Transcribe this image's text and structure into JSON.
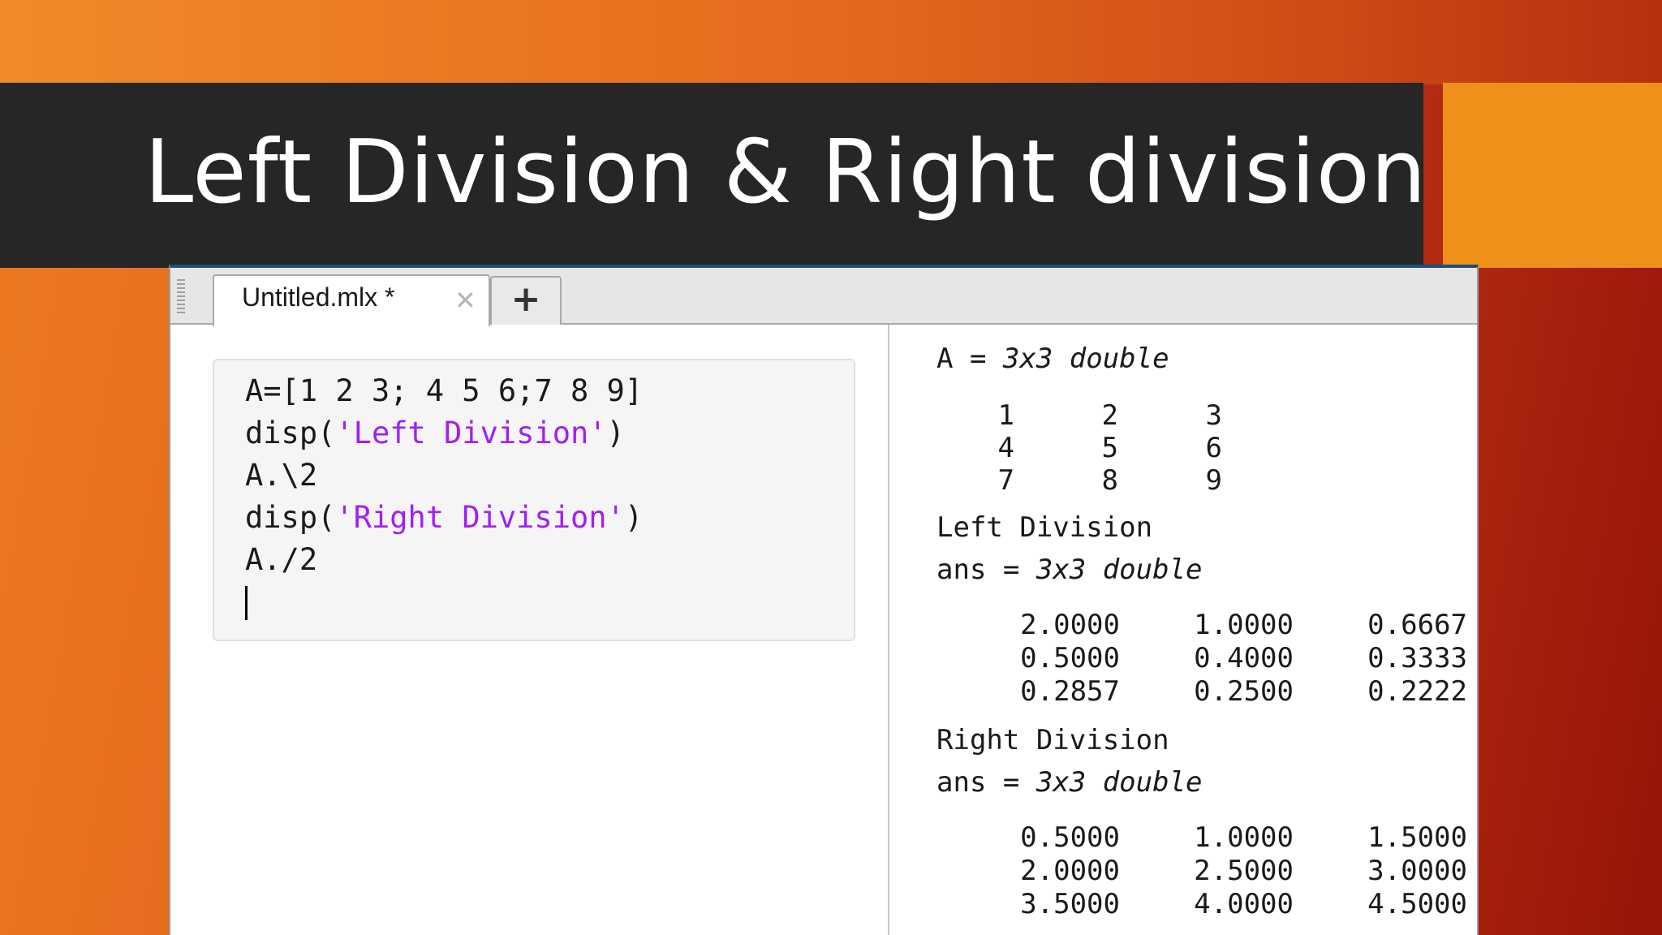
{
  "slide": {
    "title": "Left Division & Right division"
  },
  "editor": {
    "tab_label": "Untitled.mlx *",
    "tab_close_icon": "close-icon",
    "new_tab_label": "+",
    "code_lines": [
      {
        "plain": "A=[1 2 3; 4 5 6;7 8 9]",
        "pre": "",
        "str": "",
        "post": ""
      },
      {
        "plain": "",
        "pre": "disp(",
        "str": "'Left Division'",
        "post": ")"
      },
      {
        "plain": "A.\\2",
        "pre": "",
        "str": "",
        "post": ""
      },
      {
        "plain": "",
        "pre": "disp(",
        "str": "'Right Division'",
        "post": ")"
      },
      {
        "plain": "A./2",
        "pre": "",
        "str": "",
        "post": ""
      }
    ]
  },
  "output": {
    "a_label": "A = ",
    "a_type": "3x3 double",
    "a_matrix": [
      [
        "1",
        "2",
        "3"
      ],
      [
        "4",
        "5",
        "6"
      ],
      [
        "7",
        "8",
        "9"
      ]
    ],
    "left_heading": "Left Division",
    "left_ans_label": "ans = ",
    "left_ans_type": "3x3 double",
    "left_matrix": [
      [
        "2.0000",
        "1.0000",
        "0.6667"
      ],
      [
        "0.5000",
        "0.4000",
        "0.3333"
      ],
      [
        "0.2857",
        "0.2500",
        "0.2222"
      ]
    ],
    "right_heading": "Right Division",
    "right_ans_label": "ans = ",
    "right_ans_type": "3x3 double",
    "right_matrix": [
      [
        "0.5000",
        "1.0000",
        "1.5000"
      ],
      [
        "2.0000",
        "2.5000",
        "3.0000"
      ],
      [
        "3.5000",
        "4.0000",
        "4.5000"
      ]
    ]
  },
  "colors": {
    "title_bar": "#262626",
    "accent_square": "#ef9118",
    "string_literal": "#a020f0",
    "window_border": "#1d4f7a"
  }
}
